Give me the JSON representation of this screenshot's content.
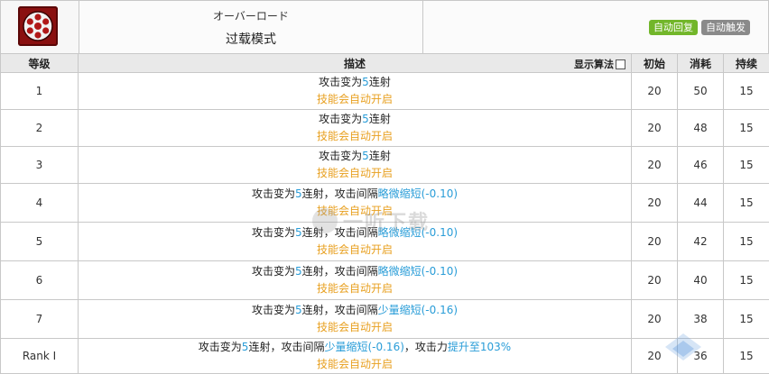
{
  "header": {
    "jp_name": "オーバーロード",
    "cn_name": "过载模式",
    "badges": [
      {
        "label": "自动回复",
        "color": "#72b62a"
      },
      {
        "label": "自动触发",
        "color": "#8a8a8a"
      }
    ],
    "icon": "revolver-cylinder-icon"
  },
  "table": {
    "headers": {
      "level": "等级",
      "desc": "描述",
      "show_algo": "显示算法",
      "initial": "初始",
      "cost": "消耗",
      "duration": "持续"
    },
    "rows": [
      {
        "level": "1",
        "line1_pre": "攻击变为",
        "line1_hl": "5",
        "line1_post": "连射",
        "line1_extra_pre": "",
        "line1_extra_hl": "",
        "line1_extra_post": "",
        "line1_tail_pre": "",
        "line1_tail_hl": "",
        "line2": "技能会自动开启",
        "initial": "20",
        "cost": "50",
        "duration": "15"
      },
      {
        "level": "2",
        "line1_pre": "攻击变为",
        "line1_hl": "5",
        "line1_post": "连射",
        "line1_extra_pre": "",
        "line1_extra_hl": "",
        "line1_extra_post": "",
        "line1_tail_pre": "",
        "line1_tail_hl": "",
        "line2": "技能会自动开启",
        "initial": "20",
        "cost": "48",
        "duration": "15"
      },
      {
        "level": "3",
        "line1_pre": "攻击变为",
        "line1_hl": "5",
        "line1_post": "连射",
        "line1_extra_pre": "",
        "line1_extra_hl": "",
        "line1_extra_post": "",
        "line1_tail_pre": "",
        "line1_tail_hl": "",
        "line2": "技能会自动开启",
        "initial": "20",
        "cost": "46",
        "duration": "15"
      },
      {
        "level": "4",
        "line1_pre": "攻击变为",
        "line1_hl": "5",
        "line1_post": "连射，攻击间隔",
        "line1_extra_pre": "",
        "line1_extra_hl": "略微缩短",
        "line1_extra_post": "(-0.10)",
        "line1_tail_pre": "",
        "line1_tail_hl": "",
        "line2": "技能会自动开启",
        "initial": "20",
        "cost": "44",
        "duration": "15"
      },
      {
        "level": "5",
        "line1_pre": "攻击变为",
        "line1_hl": "5",
        "line1_post": "连射，攻击间隔",
        "line1_extra_pre": "",
        "line1_extra_hl": "略微缩短",
        "line1_extra_post": "(-0.10)",
        "line1_tail_pre": "",
        "line1_tail_hl": "",
        "line2": "技能会自动开启",
        "initial": "20",
        "cost": "42",
        "duration": "15"
      },
      {
        "level": "6",
        "line1_pre": "攻击变为",
        "line1_hl": "5",
        "line1_post": "连射，攻击间隔",
        "line1_extra_pre": "",
        "line1_extra_hl": "略微缩短",
        "line1_extra_post": "(-0.10)",
        "line1_tail_pre": "",
        "line1_tail_hl": "",
        "line2": "技能会自动开启",
        "initial": "20",
        "cost": "40",
        "duration": "15"
      },
      {
        "level": "7",
        "line1_pre": "攻击变为",
        "line1_hl": "5",
        "line1_post": "连射，攻击间隔",
        "line1_extra_pre": "",
        "line1_extra_hl": "少量缩短",
        "line1_extra_post": "(-0.16)",
        "line1_tail_pre": "",
        "line1_tail_hl": "",
        "line2": "技能会自动开启",
        "initial": "20",
        "cost": "38",
        "duration": "15"
      },
      {
        "level": "Rank Ⅰ",
        "line1_pre": "攻击变为",
        "line1_hl": "5",
        "line1_post": "连射，攻击间隔",
        "line1_extra_pre": "",
        "line1_extra_hl": "少量缩短",
        "line1_extra_post": "(-0.16)，攻击力",
        "line1_tail_pre": "",
        "line1_tail_hl": "提升至103%",
        "line2": "技能会自动开启",
        "initial": "20",
        "cost": "36",
        "duration": "15"
      }
    ]
  },
  "watermark": {
    "text": "一听下载"
  },
  "colors": {
    "highlight": "#2a9dd8",
    "auto": "#e8a020",
    "header_bg": "#e9e9e9",
    "border": "#c8c8c8"
  }
}
